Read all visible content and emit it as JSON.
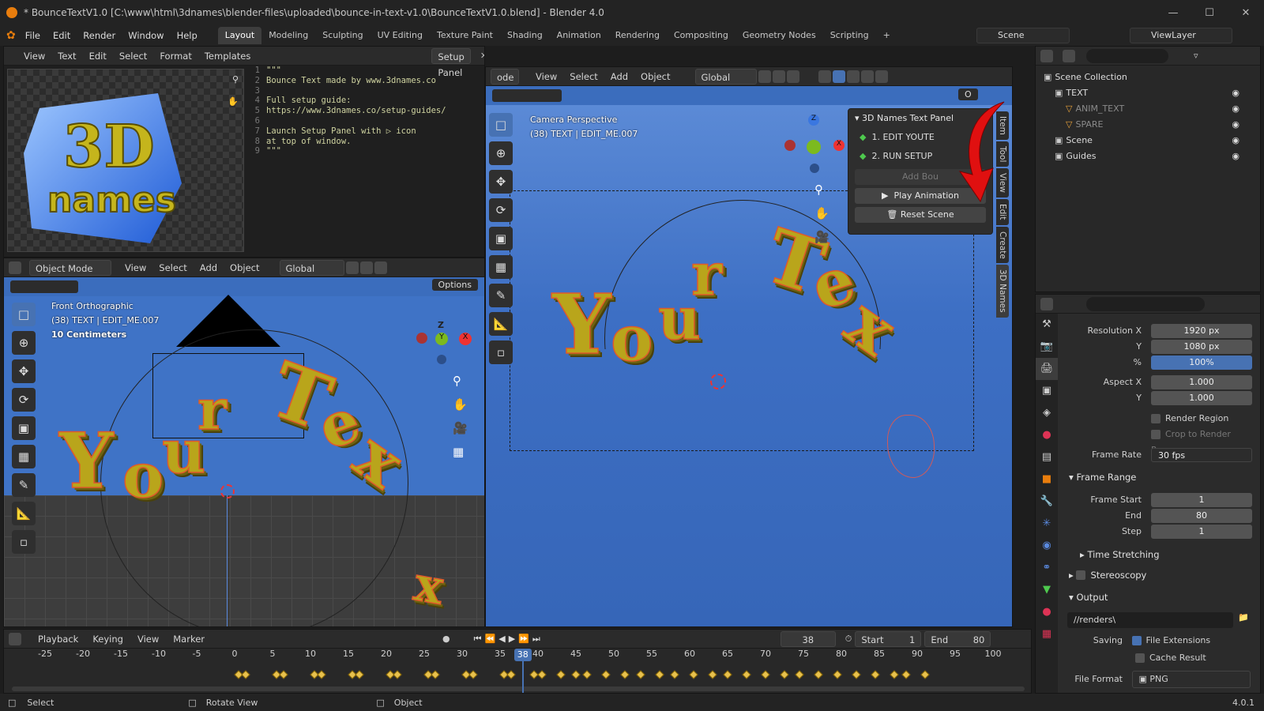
{
  "window": {
    "title": "* BounceTextV1.0 [C:\\www\\html\\3dnames\\blender-files\\uploaded\\bounce-in-text-v1.0\\BounceTextV1.0.blend] - Blender 4.0"
  },
  "menubar": {
    "menus": [
      "File",
      "Edit",
      "Render",
      "Window",
      "Help"
    ],
    "workspaces": [
      "Layout",
      "Modeling",
      "Sculpting",
      "UV Editing",
      "Texture Paint",
      "Shading",
      "Animation",
      "Rendering",
      "Compositing",
      "Geometry Nodes",
      "Scripting"
    ],
    "active_workspace": "Layout",
    "scene": "Scene",
    "view_layer": "ViewLayer"
  },
  "text_editor": {
    "menus": [
      "View",
      "Text",
      "Edit",
      "Select",
      "Format",
      "Templates"
    ],
    "file_name": "Setup Panel",
    "lines": [
      {
        "n": "1",
        "t": "\"\"\""
      },
      {
        "n": "2",
        "t": "Bounce Text made by www.3dnames.co"
      },
      {
        "n": "3",
        "t": ""
      },
      {
        "n": "4",
        "t": "Full setup guide:"
      },
      {
        "n": "5",
        "t": "https://www.3dnames.co/setup-guides/"
      },
      {
        "n": "6",
        "t": ""
      },
      {
        "n": "7",
        "t": "Launch Setup Panel with ▷ icon"
      },
      {
        "n": "8",
        "t": "at top of window."
      },
      {
        "n": "9",
        "t": "\"\"\""
      }
    ]
  },
  "image_preview": {
    "logo_text_top": "3D",
    "logo_text_bottom": "names"
  },
  "front_view": {
    "mode": "Object Mode",
    "menus": [
      "View",
      "Select",
      "Add",
      "Object"
    ],
    "orientation": "Global",
    "options_label": "Options",
    "info": [
      "Front Orthographic",
      "(38) TEXT | EDIT_ME.007",
      "10 Centimeters"
    ],
    "letters": [
      "Y",
      "o",
      "u",
      "r",
      "T",
      "e",
      "x"
    ]
  },
  "camera_view": {
    "mode_partial": "ode",
    "menus": [
      "View",
      "Select",
      "Add",
      "Object"
    ],
    "orientation": "Global",
    "options_label": "O",
    "info": [
      "Camera Perspective",
      "(38) TEXT | EDIT_ME.007"
    ],
    "letters": [
      "Y",
      "o",
      "u",
      "r",
      "T",
      "e",
      "x"
    ]
  },
  "names_panel": {
    "title": "3D Names Text Panel",
    "step1": "1. EDIT YOU",
    "step1_suffix": "TE",
    "step2": "2. RUN SETUP",
    "add_bounce": "Add Bou",
    "play": "Play Animation",
    "reset": "Reset Scene"
  },
  "npanel_tabs": [
    "Item",
    "Tool",
    "View",
    "Edit",
    "Create",
    "3D Names"
  ],
  "outliner": {
    "items": [
      {
        "name": "Scene Collection",
        "indent": 0
      },
      {
        "name": "TEXT",
        "indent": 1
      },
      {
        "name": "ANIM_TEXT",
        "indent": 2
      },
      {
        "name": "SPARE",
        "indent": 2
      },
      {
        "name": "Scene",
        "indent": 1
      },
      {
        "name": "Guides",
        "indent": 1
      }
    ]
  },
  "properties": {
    "resolution_x_label": "Resolution X",
    "resolution_x": "1920 px",
    "resolution_y_label": "Y",
    "resolution_y": "1080 px",
    "percent_label": "%",
    "percent": "100%",
    "aspect_x_label": "Aspect X",
    "aspect_x": "1.000",
    "aspect_y_label": "Y",
    "aspect_y": "1.000",
    "render_region": "Render Region",
    "crop": "Crop to Render Reg...",
    "frame_rate_label": "Frame Rate",
    "frame_rate": "30 fps",
    "frame_range_section": "Frame Range",
    "frame_start_label": "Frame Start",
    "frame_start": "1",
    "end_label": "End",
    "end": "80",
    "step_label": "Step",
    "step": "1",
    "time_stretching": "Time Stretching",
    "stereoscopy": "Stereoscopy",
    "output_section": "Output",
    "output_path": "//renders\\",
    "saving_label": "Saving",
    "file_extensions": "File Extensions",
    "cache_result": "Cache Result",
    "file_format_label": "File Format",
    "file_format": "PNG"
  },
  "timeline": {
    "menus": [
      "Playback",
      "Keying",
      "View",
      "Marker"
    ],
    "current_frame": "38",
    "start_label": "Start",
    "start": "1",
    "end_label": "End",
    "end": "80",
    "ticks": [
      "-25",
      "-20",
      "-15",
      "-10",
      "-5",
      "0",
      "5",
      "10",
      "15",
      "20",
      "25",
      "30",
      "35",
      "40",
      "45",
      "50",
      "55",
      "60",
      "65",
      "70",
      "75",
      "80",
      "85",
      "90",
      "95",
      "100"
    ],
    "keyframes": [
      0.5,
      1.5,
      5.5,
      6.5,
      10.5,
      11.5,
      15.5,
      16.5,
      20.5,
      21.5,
      25.5,
      26.5,
      30.5,
      31.5,
      35.5,
      36.5,
      39.5,
      40.5,
      43,
      45,
      46.5,
      49,
      51.5,
      53.5,
      56,
      58,
      60.5,
      63,
      65,
      67.5,
      70,
      72.5,
      74.5,
      77,
      79.5,
      82,
      84.5,
      87,
      88.5,
      91
    ]
  },
  "statusbar": {
    "items": [
      "Select",
      "Rotate View",
      "Object"
    ],
    "version": "4.0.1"
  },
  "colors": {
    "accent": "#4772b3",
    "blender_orange": "#e87d0d",
    "viewport_blue": "#4a74c4",
    "annotation_red": "#e01010"
  }
}
